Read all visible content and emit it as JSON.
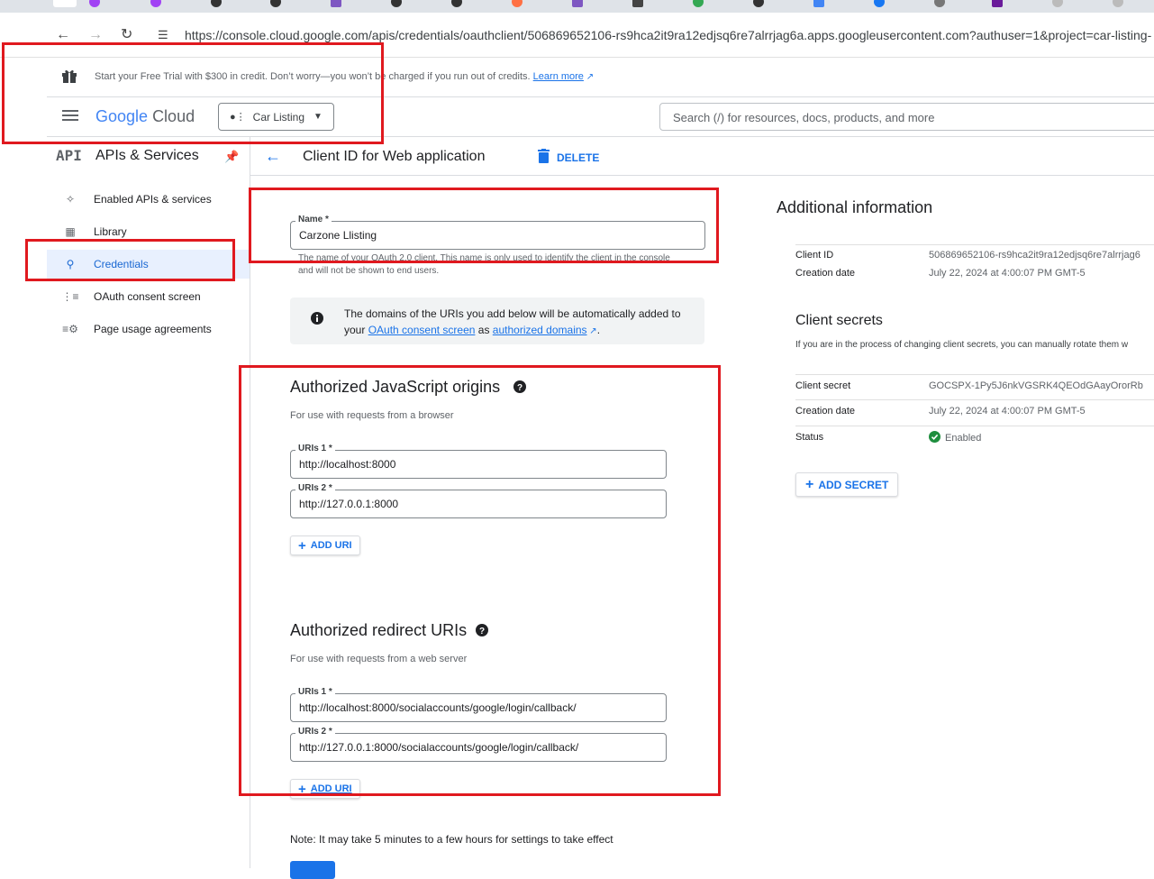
{
  "browser": {
    "url": "https://console.cloud.google.com/apis/credentials/oauthclient/506869652106-rs9hca2it9ra12edjsq6re7alrrjag6a.apps.googleusercontent.com?authuser=1&project=car-listing-"
  },
  "promo": {
    "text": "Start your Free Trial with $300 in credit. Don’t worry—you won’t be charged if you run out of credits.",
    "link": "Learn more"
  },
  "header": {
    "logo_google": "Google",
    "logo_cloud": "Cloud",
    "project": "Car Listing",
    "search_placeholder": "Search (/) for resources, docs, products, and more"
  },
  "sidebar": {
    "api_badge": "API",
    "title": "APIs & Services",
    "items": [
      {
        "label": "Enabled APIs & services",
        "icon": "hub-icon"
      },
      {
        "label": "Library",
        "icon": "library-icon"
      },
      {
        "label": "Credentials",
        "icon": "key-icon",
        "active": true
      },
      {
        "label": "OAuth consent screen",
        "icon": "consent-icon"
      },
      {
        "label": "Page usage agreements",
        "icon": "settings-list-icon"
      }
    ]
  },
  "page": {
    "title": "Client ID for Web application",
    "delete": "DELETE"
  },
  "form": {
    "name_label": "Name *",
    "name_value": "Carzone Llisting",
    "name_help": "The name of your OAuth 2.0 client. This name is only used to identify the client in the console and will not be shown to end users.",
    "info_text_1": "The domains of the URIs you add below will be automatically added to your",
    "info_link_1": "OAuth consent screen",
    "info_text_2": "as",
    "info_link_2": "authorized domains",
    "js_origins": {
      "title": "Authorized JavaScript origins",
      "subtitle": "For use with requests from a browser",
      "uris": [
        {
          "label": "URIs 1 *",
          "value": "http://localhost:8000"
        },
        {
          "label": "URIs 2 *",
          "value": "http://127.0.0.1:8000"
        }
      ],
      "add": "ADD URI"
    },
    "redirect": {
      "title": "Authorized redirect URIs",
      "subtitle": "For use with requests from a web server",
      "uris": [
        {
          "label": "URIs 1 *",
          "value": "http://localhost:8000/socialaccounts/google/login/callback/"
        },
        {
          "label": "URIs 2 *",
          "value": "http://127.0.0.1:8000/socialaccounts/google/login/callback/"
        }
      ],
      "add": "ADD URI"
    },
    "note": "Note: It may take 5 minutes to a few hours for settings to take effect"
  },
  "additional": {
    "title": "Additional information",
    "client_id_label": "Client ID",
    "client_id_value": "506869652106-rs9hca2it9ra12edjsq6re7alrrjag6",
    "creation_label": "Creation date",
    "creation_value": "July 22, 2024 at 4:00:07 PM GMT-5",
    "secrets_title": "Client secrets",
    "secrets_desc": "If you are in the process of changing client secrets, you can manually rotate them w",
    "secret_label": "Client secret",
    "secret_value": "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",
    "secret_creation_label": "Creation date",
    "secret_creation_value": "July 22, 2024 at 4:00:07 PM GMT-5",
    "status_label": "Status",
    "status_value": "Enabled",
    "add_secret": "ADD SECRET"
  },
  "colors": {
    "accent": "#1a73e8",
    "highlight_box": "#e0191f",
    "enabled": "#1e8e3e"
  }
}
